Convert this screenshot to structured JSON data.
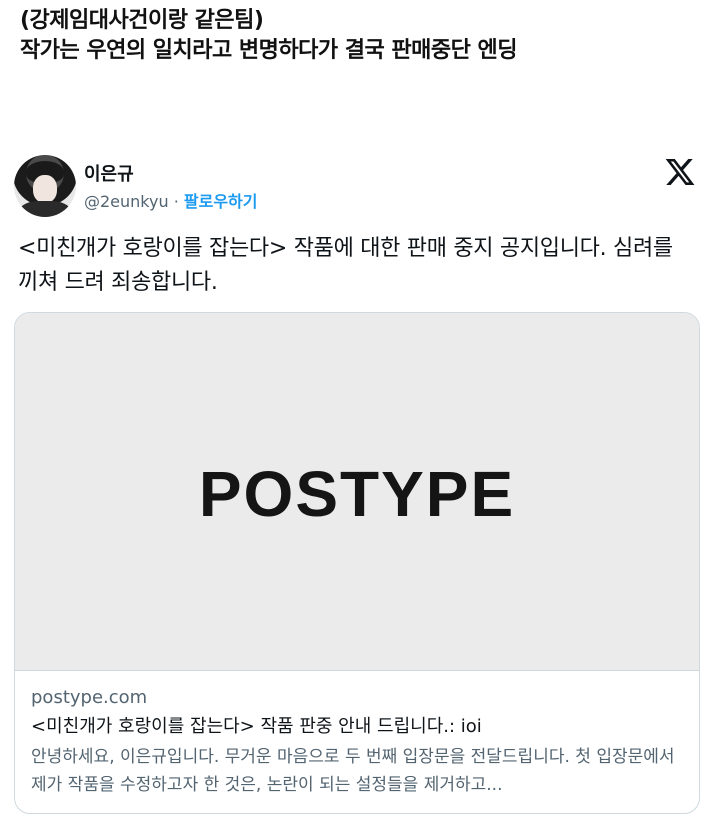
{
  "header": {
    "line1": "(강제임대사건이랑 같은팀)",
    "line2": "작가는 우연의 일치라고 변명하다가 결국 판매중단 엔딩"
  },
  "tweet": {
    "author_name": "이은규",
    "handle": "@2eunkyu",
    "separator": " · ",
    "follow_label": "팔로우하기",
    "platform_icon": "x-logo-icon",
    "text": "<미친개가 호랑이를 잡는다> 작품에 대한 판매 중지 공지입니다. 심려를 끼쳐 드려 죄송합니다.",
    "card": {
      "image_logo": "POSTYPE",
      "domain": "postype.com",
      "title": "<미친개가 호랑이를 잡는다> 작품 판중 안내 드립니다.: ioi",
      "description": "안녕하세요, 이은규입니다. 무거운 마음으로 두 번째 입장문을 전달드립니다. 첫 입장문에서 제가 작품을 수정하고자 한 것은, 논란이 되는 설정들을 제거하고..."
    }
  }
}
